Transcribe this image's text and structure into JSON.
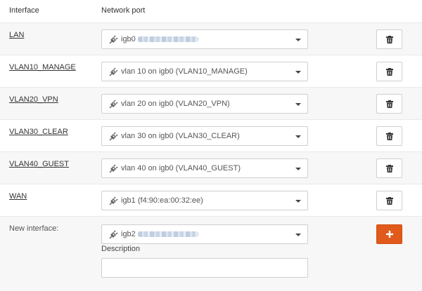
{
  "header": {
    "interface_col": "Interface",
    "network_port_col": "Network port"
  },
  "rows": [
    {
      "interface": "LAN",
      "port_prefix": "igb0",
      "port_redacted": true,
      "port_label": ""
    },
    {
      "interface": "VLAN10_MANAGE",
      "port_prefix": "",
      "port_redacted": false,
      "port_label": "vlan 10 on igb0 (VLAN10_MANAGE)"
    },
    {
      "interface": "VLAN20_VPN",
      "port_prefix": "",
      "port_redacted": false,
      "port_label": "vlan 20 on igb0 (VLAN20_VPN)"
    },
    {
      "interface": "VLAN30_CLEAR",
      "port_prefix": "",
      "port_redacted": false,
      "port_label": "vlan 30 on igb0 (VLAN30_CLEAR)"
    },
    {
      "interface": "VLAN40_GUEST",
      "port_prefix": "",
      "port_redacted": false,
      "port_label": "vlan 40 on igb0 (VLAN40_GUEST)"
    },
    {
      "interface": "WAN",
      "port_prefix": "",
      "port_redacted": false,
      "port_label": "igb1 (f4:90:ea:00:32:ee)"
    }
  ],
  "new_interface": {
    "label": "New interface:",
    "port_prefix": "igb2",
    "port_redacted": true,
    "description_label": "Description",
    "description_value": "",
    "add_icon": "plus-icon"
  },
  "icons": {
    "port": "plug-icon",
    "delete": "trash-icon",
    "dropdown": "caret-down-icon"
  },
  "colors": {
    "accent": "#e05a1b",
    "row_alt": "#f7f7f7"
  }
}
